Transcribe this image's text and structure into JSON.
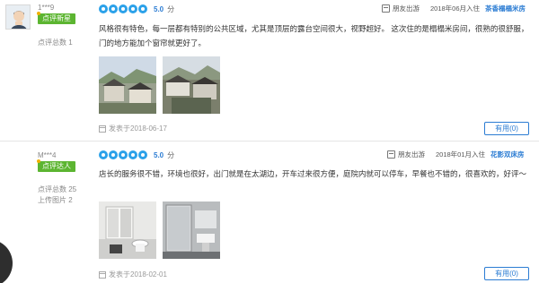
{
  "reviews": [
    {
      "user_name": "1***9",
      "badge": "点评新星",
      "review_count": "点评总数 1",
      "photo_count": "",
      "score": "5.0",
      "score_unit": "分",
      "trip_type": "朋友出游",
      "checkin": "2018年06月入住",
      "room_type": "茶香榻榻米房",
      "text": "风格很有特色，每一层都有特别的公共区域，尤其是顶层的露台空间很大，视野超好。 这次住的是榻榻米房间，很熟的很舒服，门的地方能加个窗帘就更好了。",
      "posted": "发表于2018-06-17",
      "useful": "有用(0)"
    },
    {
      "user_name": "M***4",
      "badge": "点评达人",
      "review_count": "点评总数 25",
      "photo_count": "上传图片 2",
      "score": "5.0",
      "score_unit": "分",
      "trip_type": "朋友出游",
      "checkin": "2018年01月入住",
      "room_type": "花影双床房",
      "text": "店长的服务很不错，环境也很好，出门就是在太湖边，开车过来很方便，庭院内就可以停车，早餐也不错的，很喜欢的，好评～",
      "posted": "发表于2018-02-01",
      "useful": "有用(0)"
    }
  ],
  "colors": {
    "accent": "#2b7cd3",
    "rating": "#2ba1e9",
    "badge": "#5cb531"
  },
  "icons": [
    "avatar-placeholder-icon",
    "rating-dot-icon",
    "trip-type-icon",
    "calendar-icon",
    "chevron-right-icon"
  ]
}
